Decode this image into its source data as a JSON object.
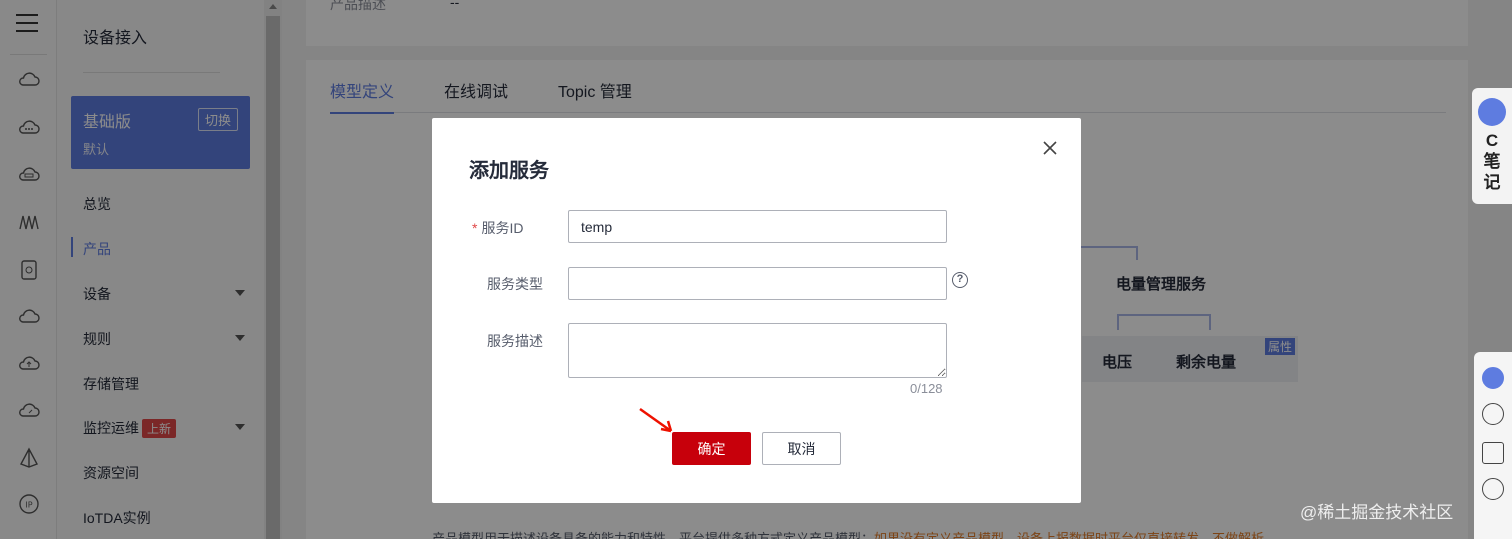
{
  "sidebar": {
    "title": "设备接入",
    "edition": {
      "name": "基础版",
      "switch_label": "切换",
      "sub": "默认"
    },
    "items": [
      {
        "label": "总览"
      },
      {
        "label": "产品"
      },
      {
        "label": "设备"
      },
      {
        "label": "规则"
      },
      {
        "label": "存储管理"
      },
      {
        "label": "监控运维",
        "badge": "上新"
      },
      {
        "label": "资源空间"
      },
      {
        "label": "IoTDA实例"
      }
    ],
    "active_item": "产品"
  },
  "product_info": {
    "desc_label": "产品描述",
    "desc_value": "--"
  },
  "tabs": [
    {
      "label": "模型定义"
    },
    {
      "label": "在线调试"
    },
    {
      "label": "Topic 管理"
    }
  ],
  "model_diagram": {
    "service_name": "电量管理服务",
    "properties": [
      "电压",
      "剩余电量"
    ],
    "tag": "属性"
  },
  "bottom_note": {
    "text": "产品模型用于描述设备具备的能力和特性，平台提供多种方式定义产品模型：",
    "warning": "如果没有定义产品模型，设备上报数据时平台仅直接转发，不做解析"
  },
  "dialog": {
    "title": "添加服务",
    "fields": {
      "service_id": {
        "label": "服务ID",
        "required_mark": "*",
        "value": "temp"
      },
      "service_type": {
        "label": "服务类型",
        "value": "",
        "help": "?"
      },
      "service_desc": {
        "label": "服务描述",
        "value": "",
        "counter": "0/128"
      }
    },
    "ok_label": "确定",
    "cancel_label": "取消"
  },
  "right_tools": {
    "note_label": "C笔记"
  },
  "watermark": "@稀土掘金技术社区",
  "colors": {
    "accent": "#5e7ce0",
    "primary_button": "#c7000b",
    "danger": "#e04848"
  }
}
